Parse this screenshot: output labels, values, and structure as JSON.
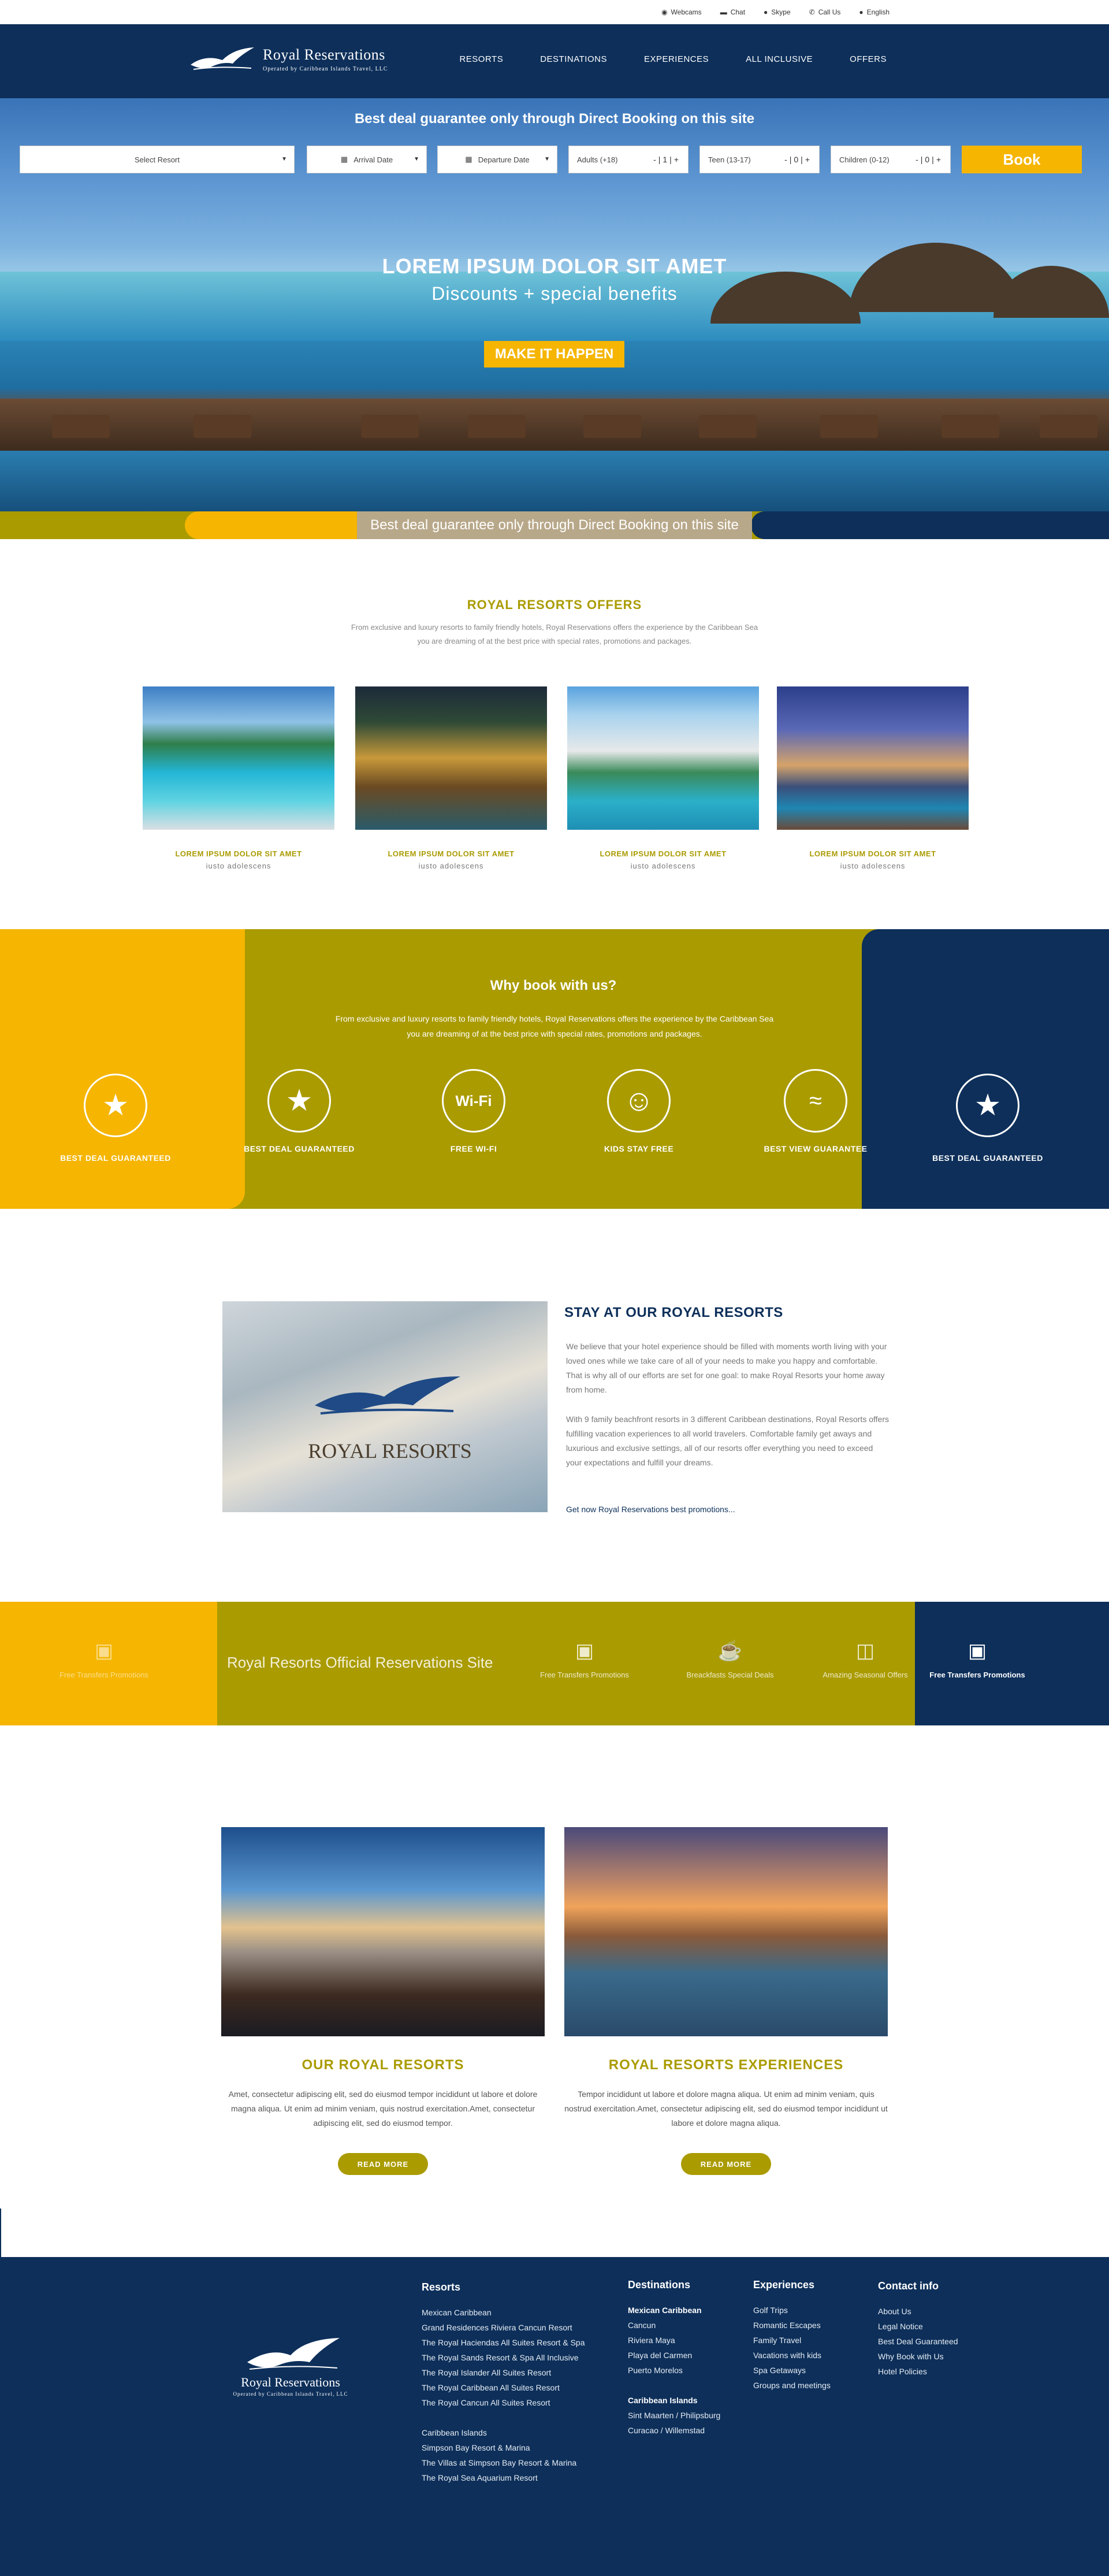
{
  "topbar": {
    "items": [
      {
        "icon": "location-pin-icon",
        "label": "Webcams"
      },
      {
        "icon": "chat-icon",
        "label": "Chat"
      },
      {
        "icon": "skype-icon",
        "label": "Skype"
      },
      {
        "icon": "phone-icon",
        "label": "Call Us"
      },
      {
        "icon": "globe-icon",
        "label": "English"
      }
    ]
  },
  "brand": {
    "name": "Royal Reservations",
    "sub": "Operated by Caribbean Islands Travel, LLC"
  },
  "nav": [
    "RESORTS",
    "DESTINATIONS",
    "EXPERIENCES",
    "ALL INCLUSIVE",
    "OFFERS"
  ],
  "hero": {
    "tagline": "Best deal guarantee only through Direct Booking on this site",
    "search": {
      "resort": "Select Resort",
      "arrival": "Arrival Date",
      "departure": "Departure Date",
      "adults_label": "Adults (+18)",
      "adults_value": "1",
      "teen_label": "Teen (13-17)",
      "teen_value": "0",
      "children_label": "Children (0-12)",
      "children_value": "0",
      "book": "Book"
    },
    "headline": "LOREM IPSUM DOLOR SIT AMET",
    "subheadline": "Discounts + special benefits",
    "cta": "MAKE IT HAPPEN",
    "strip": "Best deal guarantee only through Direct Booking on this site"
  },
  "offers": {
    "title": "ROYAL RESORTS OFFERS",
    "desc": "From exclusive and luxury resorts to family friendly hotels, Royal Reservations offers the experience by the Caribbean Sea you are dreaming of at the best price with special rates, promotions and packages.",
    "cards": [
      {
        "title": "LOREM IPSUM DOLOR SIT AMET",
        "sub": "iusto adolescens"
      },
      {
        "title": "LOREM IPSUM DOLOR SIT AMET",
        "sub": "iusto adolescens"
      },
      {
        "title": "LOREM IPSUM DOLOR SIT AMET",
        "sub": "iusto adolescens"
      },
      {
        "title": "LOREM IPSUM DOLOR SIT AMET",
        "sub": "iusto adolescens"
      }
    ]
  },
  "why": {
    "title": "Why book with us?",
    "desc": "From exclusive and luxury resorts to family friendly hotels, Royal Reservations offers the experience by the Caribbean Sea you are dreaming of at the best price with special rates, promotions and packages.",
    "features": [
      {
        "icon": "star-icon",
        "label": "BEST DEAL GUARANTEED"
      },
      {
        "icon": "star-icon",
        "label": "BEST DEAL GUARANTEED"
      },
      {
        "icon": "wifi-icon",
        "label": "FREE WI-FI",
        "glyph": "Wi-Fi"
      },
      {
        "icon": "child-icon",
        "label": "KIDS STAY FREE"
      },
      {
        "icon": "sea-view-icon",
        "label": "BEST VIEW GUARANTEE"
      },
      {
        "icon": "star-icon",
        "label": "BEST DEAL GUARANTEED"
      }
    ]
  },
  "stay": {
    "title": "STAY AT OUR ROYAL RESORTS",
    "logo_text": "ROYAL RESORTS",
    "p1": "We believe that your hotel experience should be filled with moments worth living with your loved ones while we take care of all of your needs to make you happy and comfortable. That is why all of our efforts are set for one goal: to make Royal Resorts your home away from home.",
    "p2": "With 9 family beachfront resorts in 3 different Caribbean destinations, Royal Resorts offers fulfilling vacation experiences to all world travelers. Comfortable family get aways and luxurious and exclusive settings, all of our resorts offer everything you need to exceed your expectations and fulfill your dreams.",
    "link": "Get now Royal Reservations best promotions..."
  },
  "perks": {
    "title": "Royal Resorts Official Reservations Site",
    "items": [
      {
        "icon": "car-icon",
        "label": "Free Transfers Promotions"
      },
      {
        "icon": "car-icon",
        "label": "Free Transfers Promotions"
      },
      {
        "icon": "coffee-cup-icon",
        "label": "Breackfasts Special Deals"
      },
      {
        "icon": "gift-icon",
        "label": "Amazing Seasonal Offers"
      },
      {
        "icon": "car-icon",
        "label": "Free Transfers Promotions"
      }
    ]
  },
  "cols": [
    {
      "title": "OUR ROYAL RESORTS",
      "text": "Amet, consectetur adipiscing elit, sed do eiusmod tempor incididunt ut labore et dolore magna aliqua. Ut enim ad minim veniam, quis nostrud exercitation.Amet, consectetur adipiscing elit, sed do eiusmod tempor.",
      "button": "READ MORE"
    },
    {
      "title": "ROYAL RESORTS EXPERIENCES",
      "text": "Tempor incididunt ut labore et dolore magna aliqua. Ut enim ad minim veniam, quis nostrud exercitation.Amet, consectetur adipiscing elit, sed do eiusmod tempor incididunt ut labore et dolore magna aliqua.",
      "button": "READ MORE"
    }
  ],
  "footer": {
    "resorts": {
      "title": "Resorts",
      "group1": "Mexican Caribbean",
      "items1": [
        "Grand Residences Riviera Cancun Resort",
        "The Royal Haciendas All Suites Resort & Spa",
        "The Royal Sands Resort & Spa All Inclusive",
        "The Royal Islander All Suites Resort",
        "The Royal Caribbean All Suites Resort",
        "The Royal Cancun All Suites Resort"
      ],
      "group2": "Caribbean Islands",
      "items2": [
        "Simpson Bay Resort & Marina",
        "The Villas at Simpson Bay Resort & Marina",
        "The Royal Sea Aquarium Resort"
      ]
    },
    "destinations": {
      "title": "Destinations",
      "group1": "Mexican Caribbean",
      "items1": [
        "Cancun",
        "Riviera Maya",
        "Playa del Carmen",
        "Puerto Morelos"
      ],
      "group2": "Caribbean Islands",
      "items2": [
        "Sint Maarten / Philipsburg",
        "Curacao / Willemstad"
      ]
    },
    "experiences": {
      "title": "Experiences",
      "items": [
        "Golf Trips",
        "Romantic Escapes",
        "Family Travel",
        "Vacations with kids",
        "Spa Getaways",
        "Groups and meetings"
      ]
    },
    "contact": {
      "title": "Contact info",
      "items": [
        "About Us",
        "Legal Notice",
        "Best Deal Guaranteed",
        "Why Book with Us",
        "Hotel Policies"
      ]
    }
  }
}
